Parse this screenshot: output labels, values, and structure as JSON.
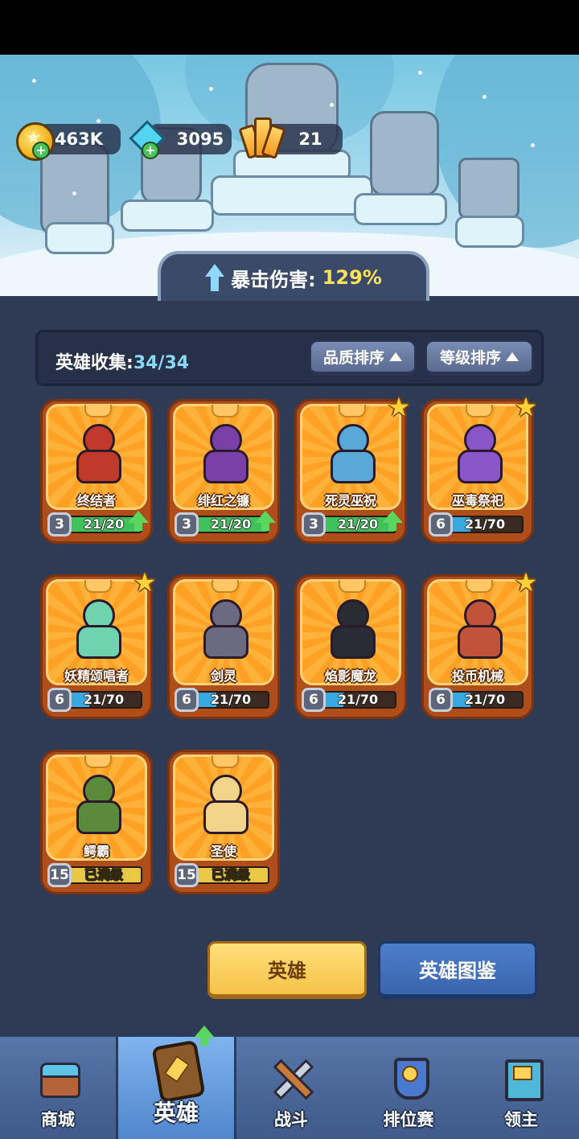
{
  "resources": {
    "gold": "463K",
    "gems": "3095",
    "crystals": "21"
  },
  "stat_banner": {
    "label": "暴击伤害:",
    "value": "129%"
  },
  "collection": {
    "label": "英雄收集:",
    "count": "34/34",
    "sort_quality": "品质排序",
    "sort_level": "等级排序"
  },
  "heroes": [
    {
      "name": "终结者",
      "level": "3",
      "progress": "21/20",
      "fill": 1.0,
      "can_upgrade": true,
      "starred": false,
      "color": "#c0392b"
    },
    {
      "name": "绯红之镰",
      "level": "3",
      "progress": "21/20",
      "fill": 1.0,
      "can_upgrade": true,
      "starred": false,
      "color": "#7b3fa8"
    },
    {
      "name": "死灵巫祝",
      "level": "3",
      "progress": "21/20",
      "fill": 1.0,
      "can_upgrade": true,
      "starred": true,
      "color": "#5aa8d8"
    },
    {
      "name": "巫毒祭祀",
      "level": "6",
      "progress": "21/70",
      "fill": 0.3,
      "can_upgrade": false,
      "starred": true,
      "color": "#8a55c7"
    },
    {
      "name": "妖精颂唱者",
      "level": "6",
      "progress": "21/70",
      "fill": 0.3,
      "can_upgrade": false,
      "starred": true,
      "color": "#6fd3b0"
    },
    {
      "name": "剑灵",
      "level": "6",
      "progress": "21/70",
      "fill": 0.3,
      "can_upgrade": false,
      "starred": false,
      "color": "#6b6a80"
    },
    {
      "name": "焰影魔龙",
      "level": "6",
      "progress": "21/70",
      "fill": 0.3,
      "can_upgrade": false,
      "starred": false,
      "color": "#2b2b33"
    },
    {
      "name": "投币机械",
      "level": "6",
      "progress": "21/70",
      "fill": 0.3,
      "can_upgrade": false,
      "starred": true,
      "color": "#c0533a"
    },
    {
      "name": "鳄霸",
      "level": "15",
      "progress": "已满级",
      "fill": 1.0,
      "can_upgrade": false,
      "starred": false,
      "max": true,
      "color": "#5a8a3a"
    },
    {
      "name": "圣使",
      "level": "15",
      "progress": "已满级",
      "fill": 1.0,
      "can_upgrade": false,
      "starred": false,
      "max": true,
      "color": "#f2d48a"
    }
  ],
  "buttons": {
    "heroes_tab": "英雄",
    "codex_tab": "英雄图鉴"
  },
  "nav": [
    {
      "label": "商城",
      "icon": "shop-chest-icon"
    },
    {
      "label": "英雄",
      "icon": "hero-card-icon",
      "active": true
    },
    {
      "label": "战斗",
      "icon": "crossed-swords-icon"
    },
    {
      "label": "排位赛",
      "icon": "ranked-shield-icon"
    },
    {
      "label": "领主",
      "icon": "lord-banner-icon"
    }
  ],
  "colors": {
    "bar_green": "#3fc25b",
    "bar_blue": "#38a8e0",
    "bar_max": "#e8c845",
    "accent_yellow": "#ffe15a"
  }
}
